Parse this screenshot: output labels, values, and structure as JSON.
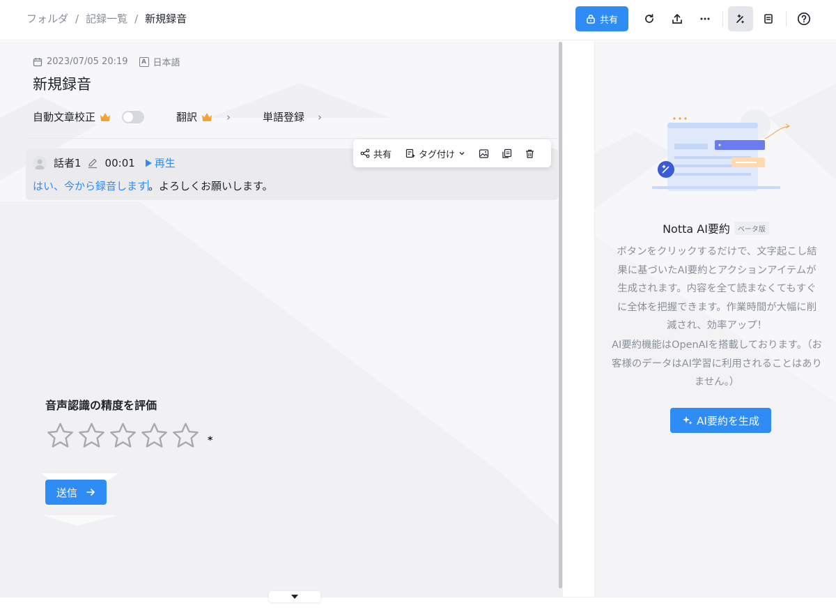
{
  "breadcrumb": {
    "items": [
      "フォルダ",
      "記録一覧"
    ],
    "separator": "/",
    "current": "新規録音"
  },
  "toolbar": {
    "share_label": "共有",
    "icons": [
      "lock-icon",
      "refresh-icon",
      "upload-icon",
      "more-icon",
      "ai-magic-icon",
      "notes-icon",
      "help-icon"
    ]
  },
  "recording": {
    "datetime": "2023/07/05 20:19",
    "language_badge": "A",
    "language": "日本語",
    "title": "新規録音"
  },
  "options": {
    "proofread_label": "自動文章校正",
    "translate_label": "翻訳",
    "vocab_label": "単語登録"
  },
  "segment": {
    "speaker": "話者1",
    "timestamp": "00:01",
    "play_label": "再生",
    "text_highlight": "はい、今から録音します",
    "text_rest": "。よろしくお願いします。"
  },
  "segment_toolbar": {
    "share_label": "共有",
    "tag_label": "タグ付け"
  },
  "rating": {
    "title": "音声認識の精度を評価",
    "stars_total": 5,
    "stars_selected": 0,
    "required_mark": "*",
    "submit_label": "送信"
  },
  "ai_summary": {
    "title": "Notta AI要約",
    "beta": "ベータ版",
    "description": "ボタンをクリックするだけで、文字起こし結果に基づいたAI要約とアクションアイテムが生成されます。内容を全て読まなくてもすぐに全体を把握できます。作業時間が大幅に削減され、効率アップ！",
    "note": "AI要約機能はOpenAIを搭載しております。（お客様のデータはAI学習に利用されることはありません。）",
    "button_label": "AI要約を生成"
  },
  "colors": {
    "accent": "#2f8cf4",
    "crown": "#f4a33a"
  }
}
